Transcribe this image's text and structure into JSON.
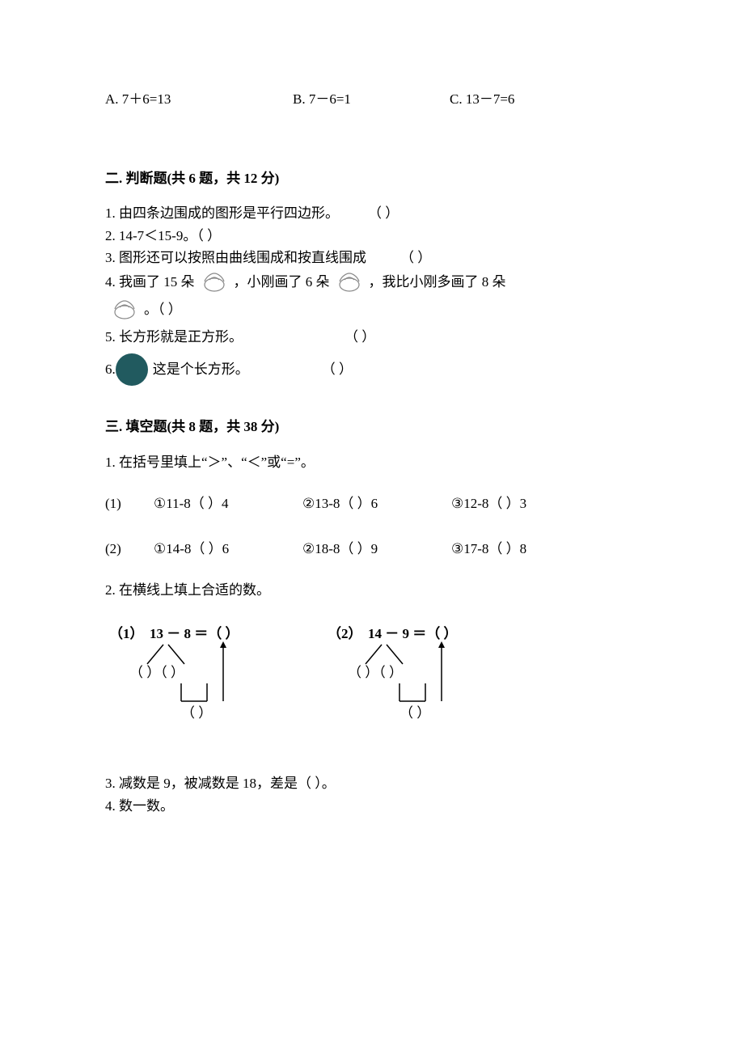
{
  "choices": {
    "a": "A. 7＋6=13",
    "b": "B. 7－6=1",
    "c": "C. 13－7=6"
  },
  "section2": {
    "heading": "二. 判断题(共 6 题，共 12 分)",
    "q1_text": "1. 由四条边围成的图形是平行四边形。",
    "q2_text": "2. 14-7＜15-9。（    ）",
    "q3_text": "3. 图形还可以按照由曲线围成和按直线围成",
    "q4_pre": "4. 我画了 15 朵",
    "q4_mid": "，小刚画了 6 朵",
    "q4_post": "，我比小刚多画了 8 朵",
    "q4_end": "。（    ）",
    "q5_text": "5. 长方形就是正方形。",
    "q6_pre": "6. ",
    "q6_post": "这是个长方形。",
    "paren": "（    ）"
  },
  "section3": {
    "heading": "三. 填空题(共 8 题，共 38 分)",
    "q1_text": "1. 在括号里填上“＞”、“＜”或“=”。",
    "row1_lead": "(1)",
    "row1_c1": "①11-8（    ）4",
    "row1_c2": "②13-8（    ）6",
    "row1_c3": "③12-8（    ）3",
    "row2_lead": "(2)",
    "row2_c1": "①14-8（    ）6",
    "row2_c2": "②18-8（    ）9",
    "row2_c3": "③17-8（    ）8",
    "q2_text": "2. 在横线上填上合适的数。",
    "d1_label": "（1）",
    "d1_expr": "13 － 8 ＝（  ）",
    "d2_label": "（2）",
    "d2_expr": "14 － 9 ＝（  ）",
    "d_pair": "（  ）（  ）",
    "d_single": "（  ）",
    "q3_text": "3. 减数是 9，被减数是 18，差是（    ）。",
    "q4_text": "4. 数一数。"
  }
}
